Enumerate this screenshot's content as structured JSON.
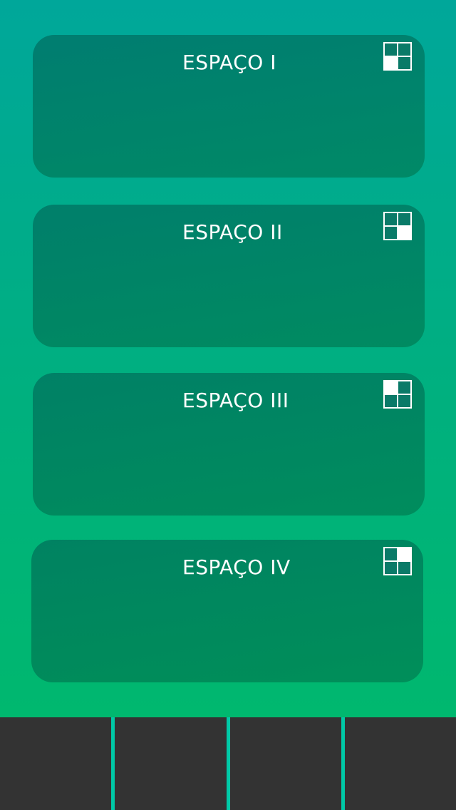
{
  "colors": {
    "background_top": "#00a79a",
    "background_bottom": "#00ba6a",
    "tabbar": "#333333",
    "tab_divider": "#00c9a7",
    "text": "#ffffff"
  },
  "spaces": [
    {
      "title": "ESPAÇO I",
      "icon": "grid-quadrant-bottom-left-icon",
      "active_cell": "bottom-left"
    },
    {
      "title": "ESPAÇO II",
      "icon": "grid-quadrant-bottom-right-icon",
      "active_cell": "bottom-right"
    },
    {
      "title": "ESPAÇO III",
      "icon": "grid-quadrant-top-left-icon",
      "active_cell": "top-left"
    },
    {
      "title": "ESPAÇO IV",
      "icon": "grid-quadrant-top-right-icon",
      "active_cell": "top-right"
    }
  ],
  "tabbar": {
    "tabs": [
      "",
      "",
      "",
      ""
    ]
  }
}
